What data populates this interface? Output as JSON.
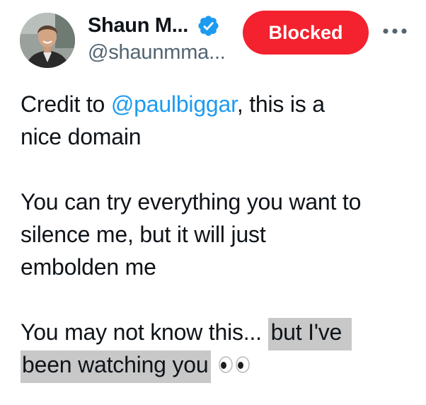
{
  "author": {
    "display_name": "Shaun M...",
    "handle": "@shaunmma...",
    "verified": true,
    "avatar_icon": "profile-photo"
  },
  "actions": {
    "blocked_label": "Blocked",
    "blocked_color": "#f4212e",
    "more_icon": "more-horizontal-icon"
  },
  "tweet": {
    "line1_prefix": "Credit to ",
    "mention": "@paulbiggar",
    "line1_suffix": ", this is a",
    "line2": "nice domain",
    "para2_line1": "You can try everything you want to",
    "para2_line2": "silence me, but it will just",
    "para2_line3": "embolden me",
    "para3_plain": "You may not know this... ",
    "para3_highlight1": "but I've",
    "para3_highlight2": "been watching you",
    "emoji_icon": "eyes-emoji"
  },
  "colors": {
    "mention": "#1d9bf0",
    "verified": "#1d9bf0",
    "highlight": "#c8c8c8",
    "secondary_text": "#536471"
  }
}
